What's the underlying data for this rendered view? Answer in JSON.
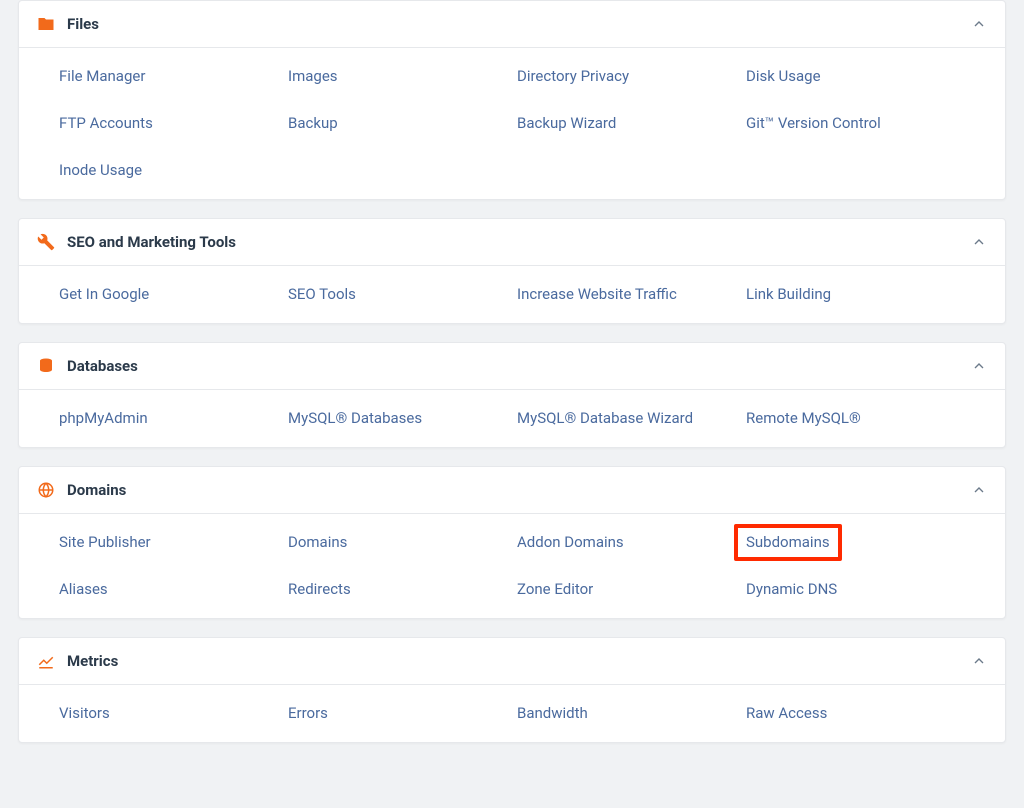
{
  "panels": [
    {
      "id": "files",
      "title": "Files",
      "icon": "folder-icon",
      "items": [
        "File Manager",
        "Images",
        "Directory Privacy",
        "Disk Usage",
        "FTP Accounts",
        "Backup",
        "Backup Wizard",
        "Git™ Version Control",
        "Inode Usage"
      ]
    },
    {
      "id": "seo",
      "title": "SEO and Marketing Tools",
      "icon": "tools-icon",
      "items": [
        "Get In Google",
        "SEO Tools",
        "Increase Website Traffic",
        "Link Building"
      ]
    },
    {
      "id": "databases",
      "title": "Databases",
      "icon": "database-icon",
      "items": [
        "phpMyAdmin",
        "MySQL® Databases",
        "MySQL® Database Wizard",
        "Remote MySQL®"
      ]
    },
    {
      "id": "domains",
      "title": "Domains",
      "icon": "globe-icon",
      "items": [
        "Site Publisher",
        "Domains",
        "Addon Domains",
        "Subdomains",
        "Aliases",
        "Redirects",
        "Zone Editor",
        "Dynamic DNS"
      ],
      "highlight_index": 3
    },
    {
      "id": "metrics",
      "title": "Metrics",
      "icon": "chart-icon",
      "items": [
        "Visitors",
        "Errors",
        "Bandwidth",
        "Raw Access"
      ]
    }
  ]
}
